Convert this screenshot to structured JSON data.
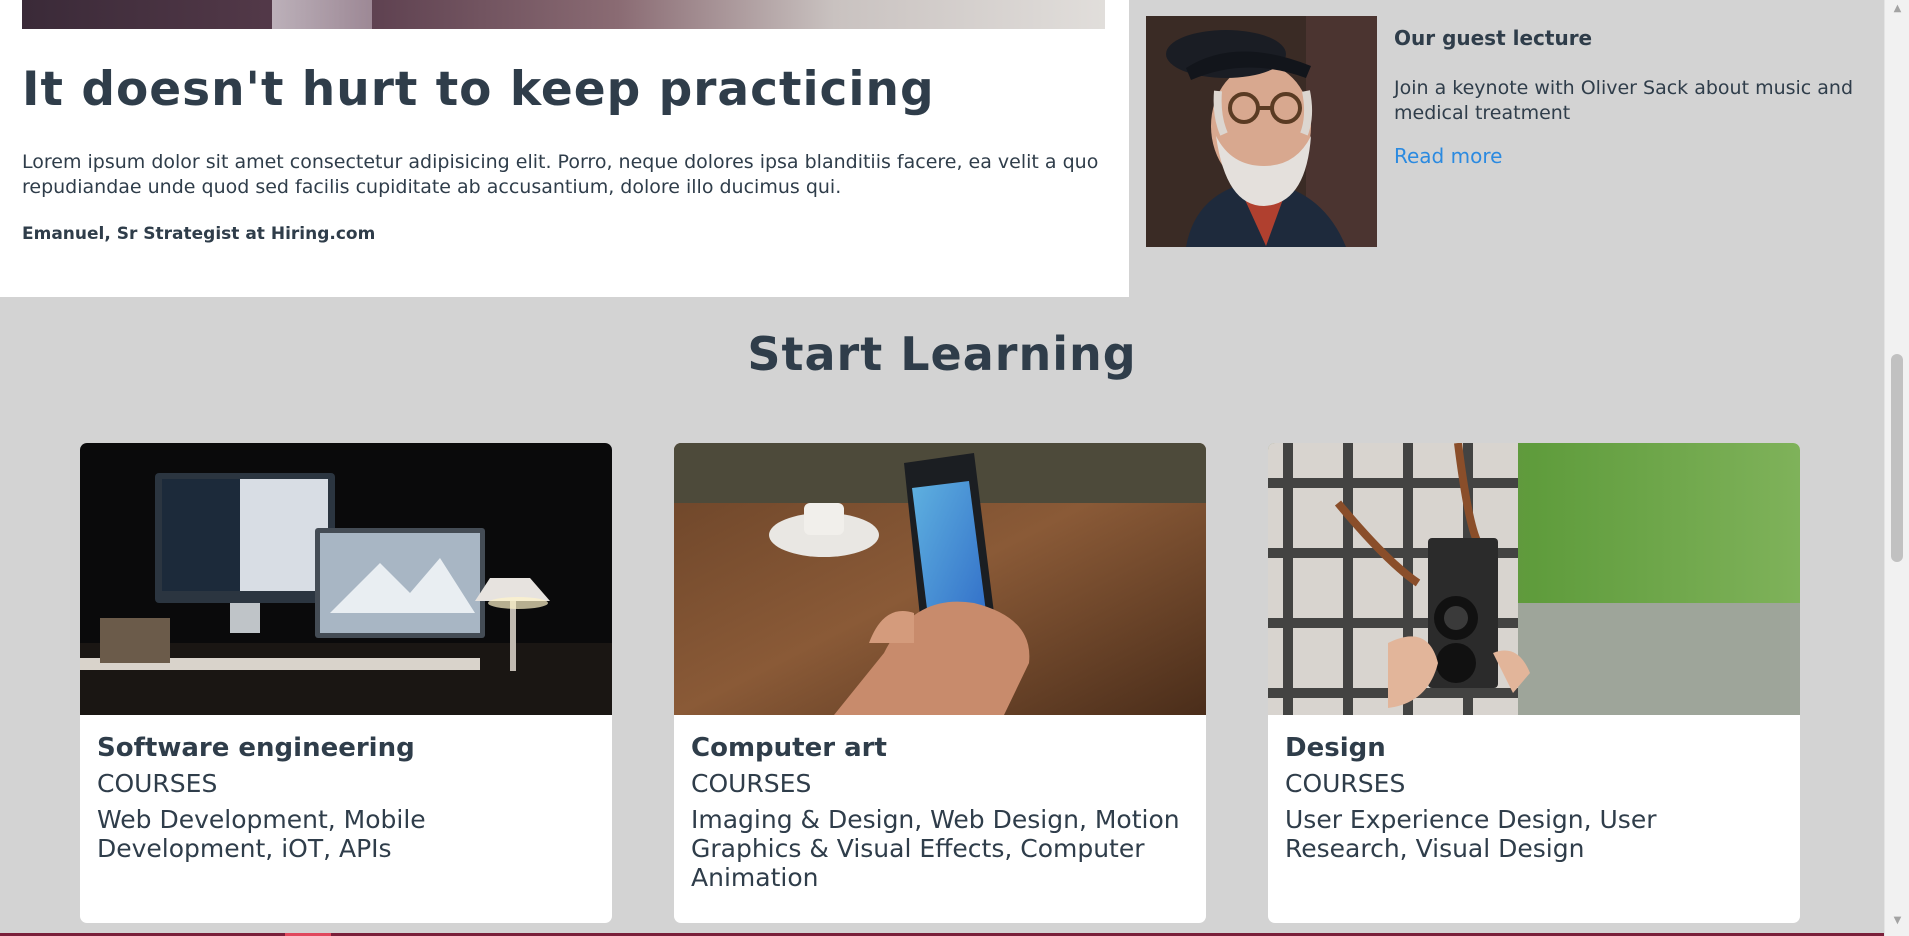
{
  "feature": {
    "title": "It doesn't hurt to keep practicing",
    "text": "Lorem ipsum dolor sit amet consectetur adipisicing elit. Porro, neque dolores ipsa blanditiis facere, ea velit a quo repudiandae unde quod sed facilis cupiditate ab accusantium, dolore illo ducimus qui.",
    "author": "Emanuel, Sr Strategist at Hiring.com"
  },
  "lecture": {
    "title": "Our guest lecture",
    "text": "Join a keynote with Oliver Sack about music and medical treatment",
    "link": "Read more"
  },
  "section": {
    "title": "Start Learning"
  },
  "cards": [
    {
      "title": "Software engineering",
      "subtitle": "COURSES",
      "text": "Web Development, Mobile Development, iOT, APIs",
      "image": "desk-computers-photo"
    },
    {
      "title": "Computer art",
      "subtitle": "COURSES",
      "text": "Imaging & Design, Web Design, Motion Graphics & Visual Effects, Computer Animation",
      "image": "phone-in-hand-photo"
    },
    {
      "title": "Design",
      "subtitle": "COURSES",
      "text": "User Experience Design, User Research, Visual Design",
      "image": "camera-photo"
    }
  ],
  "colors": {
    "heading": "#2f3d4a",
    "link": "#2b8ae0",
    "background": "#d3d3d3"
  }
}
